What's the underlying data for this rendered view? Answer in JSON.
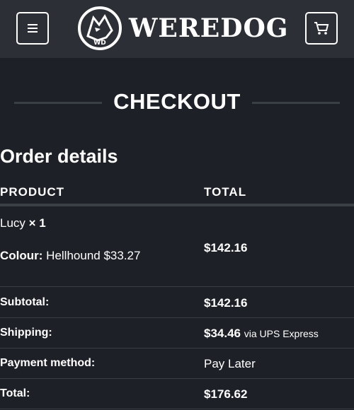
{
  "header": {
    "logo_text": "WEREDOG",
    "logo_monogram": "WD",
    "menu_icon": "hamburger-menu-icon",
    "cart_icon": "cart-icon"
  },
  "page": {
    "title": "CHECKOUT",
    "section_title": "Order details"
  },
  "table": {
    "headers": {
      "product": "PRODUCT",
      "total": "TOTAL"
    },
    "item": {
      "name": "Lucy",
      "quantity": "× 1",
      "variant_label": "Colour:",
      "variant_value": "Hellhound $33.27",
      "total": "$142.16"
    },
    "summary": [
      {
        "label": "Subtotal:",
        "value": "$142.16",
        "note": ""
      },
      {
        "label": "Shipping:",
        "value": "$34.46",
        "note": "via UPS Express"
      },
      {
        "label": "Payment method:",
        "value": "Pay Later",
        "note": ""
      },
      {
        "label": "Total:",
        "value": "$176.62",
        "note": ""
      }
    ]
  },
  "colors": {
    "header_bg": "#2c2f35",
    "page_bg": "#1d2026",
    "divider": "#3a3e45",
    "text": "#ffffff"
  }
}
